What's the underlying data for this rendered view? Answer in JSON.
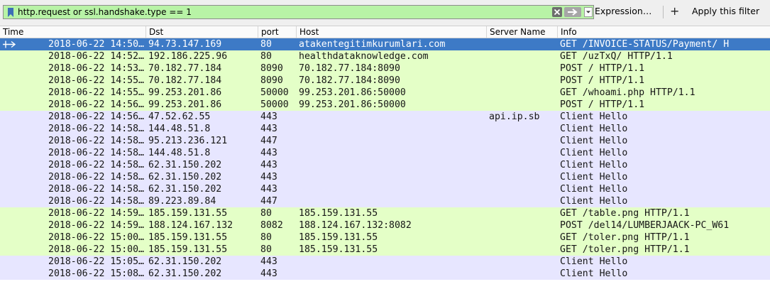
{
  "filter": {
    "value": "http.request or ssl.handshake.type == 1",
    "expression_label": "Expression…",
    "add_icon": "+",
    "apply_label": "Apply this filter"
  },
  "columns": {
    "time": "Time",
    "dst": "Dst",
    "port": "port",
    "host": "Host",
    "server_name": "Server Name",
    "info": "Info"
  },
  "colors": {
    "http_row": "#e4ffc7",
    "tls_row": "#e7e6ff",
    "selected_row": "#3d7ac6",
    "filter_valid": "#b8f3a6"
  },
  "packets": [
    {
      "time": "2018-06-22 14:50…",
      "dst": "94.73.147.169",
      "port": "80",
      "host": "atakentegitimkurumlari.com",
      "server_name": "",
      "info": "GET /INVOICE-STATUS/Payment/ H",
      "kind": "http",
      "selected": true
    },
    {
      "time": "2018-06-22 14:52…",
      "dst": "192.186.225.96",
      "port": "80",
      "host": "healthdataknowledge.com",
      "server_name": "",
      "info": "GET /uzTxQ/ HTTP/1.1",
      "kind": "http"
    },
    {
      "time": "2018-06-22 14:53…",
      "dst": "70.182.77.184",
      "port": "8090",
      "host": "70.182.77.184:8090",
      "server_name": "",
      "info": "POST / HTTP/1.1",
      "kind": "http"
    },
    {
      "time": "2018-06-22 14:55…",
      "dst": "70.182.77.184",
      "port": "8090",
      "host": "70.182.77.184:8090",
      "server_name": "",
      "info": "POST / HTTP/1.1",
      "kind": "http"
    },
    {
      "time": "2018-06-22 14:55…",
      "dst": "99.253.201.86",
      "port": "50000",
      "host": "99.253.201.86:50000",
      "server_name": "",
      "info": "GET /whoami.php HTTP/1.1",
      "kind": "http"
    },
    {
      "time": "2018-06-22 14:56…",
      "dst": "99.253.201.86",
      "port": "50000",
      "host": "99.253.201.86:50000",
      "server_name": "",
      "info": "POST / HTTP/1.1",
      "kind": "http"
    },
    {
      "time": "2018-06-22 14:56…",
      "dst": "47.52.62.55",
      "port": "443",
      "host": "",
      "server_name": "api.ip.sb",
      "info": "Client Hello",
      "kind": "tls"
    },
    {
      "time": "2018-06-22 14:58…",
      "dst": "144.48.51.8",
      "port": "443",
      "host": "",
      "server_name": "",
      "info": "Client Hello",
      "kind": "tls"
    },
    {
      "time": "2018-06-22 14:58…",
      "dst": "95.213.236.121",
      "port": "447",
      "host": "",
      "server_name": "",
      "info": "Client Hello",
      "kind": "tls"
    },
    {
      "time": "2018-06-22 14:58…",
      "dst": "144.48.51.8",
      "port": "443",
      "host": "",
      "server_name": "",
      "info": "Client Hello",
      "kind": "tls"
    },
    {
      "time": "2018-06-22 14:58…",
      "dst": "62.31.150.202",
      "port": "443",
      "host": "",
      "server_name": "",
      "info": "Client Hello",
      "kind": "tls"
    },
    {
      "time": "2018-06-22 14:58…",
      "dst": "62.31.150.202",
      "port": "443",
      "host": "",
      "server_name": "",
      "info": "Client Hello",
      "kind": "tls"
    },
    {
      "time": "2018-06-22 14:58…",
      "dst": "62.31.150.202",
      "port": "443",
      "host": "",
      "server_name": "",
      "info": "Client Hello",
      "kind": "tls"
    },
    {
      "time": "2018-06-22 14:58…",
      "dst": "89.223.89.84",
      "port": "447",
      "host": "",
      "server_name": "",
      "info": "Client Hello",
      "kind": "tls"
    },
    {
      "time": "2018-06-22 14:59…",
      "dst": "185.159.131.55",
      "port": "80",
      "host": "185.159.131.55",
      "server_name": "",
      "info": "GET /table.png HTTP/1.1",
      "kind": "http"
    },
    {
      "time": "2018-06-22 14:59…",
      "dst": "188.124.167.132",
      "port": "8082",
      "host": "188.124.167.132:8082",
      "server_name": "",
      "info": "POST /del14/LUMBERJAACK-PC_W61",
      "kind": "http"
    },
    {
      "time": "2018-06-22 15:00…",
      "dst": "185.159.131.55",
      "port": "80",
      "host": "185.159.131.55",
      "server_name": "",
      "info": "GET /toler.png HTTP/1.1",
      "kind": "http"
    },
    {
      "time": "2018-06-22 15:00…",
      "dst": "185.159.131.55",
      "port": "80",
      "host": "185.159.131.55",
      "server_name": "",
      "info": "GET /toler.png HTTP/1.1",
      "kind": "http"
    },
    {
      "time": "2018-06-22 15:05…",
      "dst": "62.31.150.202",
      "port": "443",
      "host": "",
      "server_name": "",
      "info": "Client Hello",
      "kind": "tls"
    },
    {
      "time": "2018-06-22 15:08…",
      "dst": "62.31.150.202",
      "port": "443",
      "host": "",
      "server_name": "",
      "info": "Client Hello",
      "kind": "tls"
    }
  ]
}
